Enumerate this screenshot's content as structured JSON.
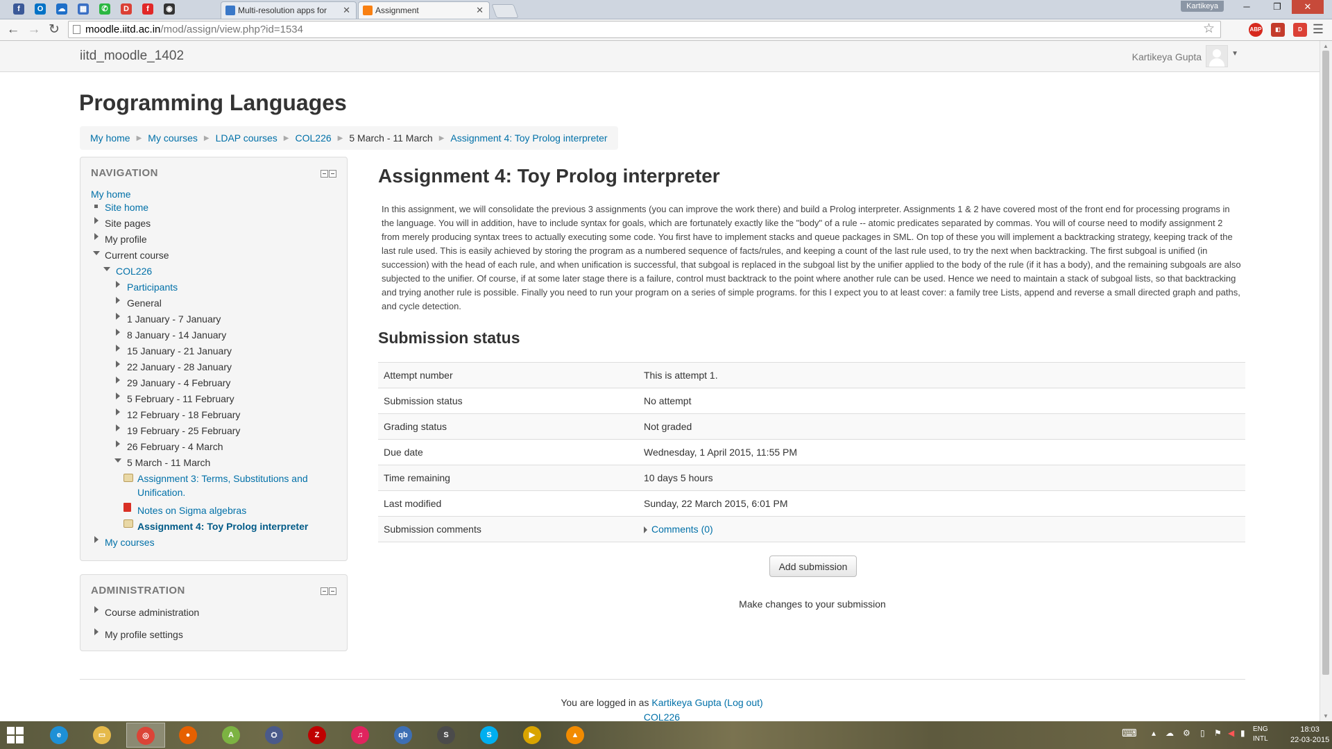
{
  "browser": {
    "pinned_tabs": [
      {
        "icon": "facebook-icon",
        "letter": "f",
        "color": "#3b5998"
      },
      {
        "icon": "outlook-icon",
        "letter": "O",
        "color": "#0072c6"
      },
      {
        "icon": "onedrive-icon",
        "letter": "☁",
        "color": "#1e6fc8"
      },
      {
        "icon": "calendar-icon",
        "letter": "▦",
        "color": "#3a6fc4"
      },
      {
        "icon": "whatsapp-icon",
        "letter": "✆",
        "color": "#2bb741"
      },
      {
        "icon": "todoist-icon",
        "letter": "D",
        "color": "#db4035"
      },
      {
        "icon": "flipboard-icon",
        "letter": "f",
        "color": "#e12828"
      },
      {
        "icon": "github-icon",
        "letter": "◉",
        "color": "#333333"
      }
    ],
    "tabs": [
      {
        "title": "Multi-resolution apps for",
        "active": false
      },
      {
        "title": "Assignment",
        "active": true
      }
    ],
    "profile_name": "Kartikeya",
    "url_host": "moodle.iitd.ac.in",
    "url_path": "/mod/assign/view.php?id=1534"
  },
  "site": {
    "brand": "iitd_moodle_1402",
    "user_name": "Kartikeya Gupta"
  },
  "course_title": "Programming Languages",
  "breadcrumb": [
    "My home",
    "My courses",
    "LDAP courses",
    "COL226",
    "5 March - 11 March",
    "Assignment 4: Toy Prolog interpreter"
  ],
  "navigation": {
    "title": "NAVIGATION",
    "my_home": "My home",
    "site_home": "Site home",
    "site_pages": "Site pages",
    "my_profile": "My profile",
    "current_course": "Current course",
    "course": "COL226",
    "course_items": [
      "Participants",
      "General",
      "1 January - 7 January",
      "8 January - 14 January",
      "15 January - 21 January",
      "22 January - 28 January",
      "29 January - 4 February",
      "5 February - 11 February",
      "12 February - 18 February",
      "19 February - 25 February",
      "26 February - 4 March",
      "5 March - 11 March"
    ],
    "activity_1_line1": "Assignment 3: Terms, Substitutions and",
    "activity_1_line2": "Unification.",
    "activity_2": "Notes on Sigma algebras",
    "activity_3": "Assignment 4: Toy Prolog interpreter",
    "my_courses": "My courses"
  },
  "administration": {
    "title": "ADMINISTRATION",
    "course_admin": "Course administration",
    "profile_settings": "My profile settings"
  },
  "assignment": {
    "title": "Assignment 4: Toy Prolog interpreter",
    "intro": "In this assignment, we will consolidate the previous 3 assignments (you can improve the work there) and build a Prolog interpreter. Assignments 1 & 2 have covered most of the front end for processing programs in the language. You will in addition, have to include syntax for goals, which are fortunately exactly like the \"body\" of a rule -- atomic predicates separated by commas. You will of course need to modify assignment 2 from merely producing syntax trees to actually executing some code. You first have to implement stacks and queue packages in SML. On top of these you will implement a backtracking strategy, keeping track of the last rule used. This is easily achieved by storing the program as a numbered sequence of facts/rules, and keeping a count of the last rule used, to try the next when backtracking. The first subgoal is unified (in succession) with the head of each rule, and when unification is successful, that subgoal is replaced in the subgoal list by the unifier applied to the body of the rule (if it has a body), and the remaining subgoals are also subjected to the unifier. Of course, if at some later stage there is a failure, control must backtrack to the point where another rule can be used. Hence we need to maintain a stack of subgoal lists, so that backtracking and trying another rule is possible. Finally you need to run your program on a series of simple programs. for this I expect you to at least cover: a family tree Lists, append and reverse a small directed graph and paths, and cycle detection."
  },
  "submission": {
    "heading": "Submission status",
    "rows": [
      {
        "label": "Attempt number",
        "value": "This is attempt 1."
      },
      {
        "label": "Submission status",
        "value": "No attempt"
      },
      {
        "label": "Grading status",
        "value": "Not graded"
      },
      {
        "label": "Due date",
        "value": "Wednesday, 1 April 2015, 11:55 PM"
      },
      {
        "label": "Time remaining",
        "value": "10 days 5 hours"
      },
      {
        "label": "Last modified",
        "value": "Sunday, 22 March 2015, 6:01 PM"
      }
    ],
    "comments_label": "Submission comments",
    "comments_link": "Comments (0)",
    "add_button": "Add submission",
    "add_help": "Make changes to your submission"
  },
  "footer": {
    "logged_in_prefix": "You are logged in as",
    "user_link": "Kartikeya Gupta",
    "logout": "(Log out)",
    "course_link": "COL226"
  },
  "taskbar": {
    "apps": [
      {
        "icon": "internet-explorer-icon",
        "color": "#1e90d6",
        "glyph": "e",
        "active": false
      },
      {
        "icon": "file-explorer-icon",
        "color": "#e5b94a",
        "glyph": "▭",
        "active": false
      },
      {
        "icon": "chrome-icon",
        "color": "#db4437",
        "glyph": "◎",
        "active": true
      },
      {
        "icon": "firefox-icon",
        "color": "#e66000",
        "glyph": "●",
        "active": false
      },
      {
        "icon": "android-studio-icon",
        "color": "#7cb342",
        "glyph": "A",
        "active": false
      },
      {
        "icon": "network-tool-icon",
        "color": "#4a5a8a",
        "glyph": "⛭",
        "active": false
      },
      {
        "icon": "filezilla-icon",
        "color": "#bf0000",
        "glyph": "Z",
        "active": false
      },
      {
        "icon": "itunes-icon",
        "color": "#e0245e",
        "glyph": "♫",
        "active": false
      },
      {
        "icon": "qbittorrent-icon",
        "color": "#3d6fb4",
        "glyph": "qb",
        "active": false
      },
      {
        "icon": "sublime-text-icon",
        "color": "#4b4b4b",
        "glyph": "S",
        "active": false
      },
      {
        "icon": "skype-icon",
        "color": "#00aff0",
        "glyph": "S",
        "active": false
      },
      {
        "icon": "media-player-icon",
        "color": "#d9a400",
        "glyph": "▶",
        "active": false
      },
      {
        "icon": "vlc-icon",
        "color": "#f28b00",
        "glyph": "▲",
        "active": false
      }
    ],
    "lang_line1": "ENG",
    "lang_line2": "INTL",
    "time": "18:03",
    "date": "22-03-2015"
  }
}
